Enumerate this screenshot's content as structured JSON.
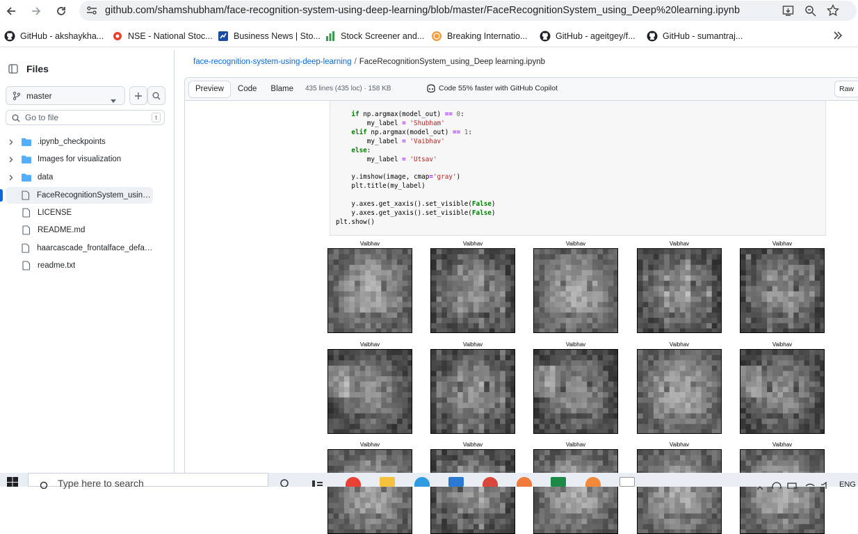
{
  "browser": {
    "url": "github.com/shamshubham/face-recognition-system-using-deep-learning/blob/master/FaceRecognitionSystem_using_Deep%20learning.ipynb",
    "bookmarks": [
      {
        "label": "GitHub - akshaykha...",
        "icon": "github-icon"
      },
      {
        "label": "NSE - National Stoc...",
        "icon": "nse-icon"
      },
      {
        "label": "Business News | Sto...",
        "icon": "business-news-icon"
      },
      {
        "label": "Stock Screener and...",
        "icon": "stock-screener-icon"
      },
      {
        "label": "Breaking Internatio...",
        "icon": "news-icon"
      },
      {
        "label": "GitHub - ageitgey/f...",
        "icon": "github-icon"
      },
      {
        "label": "GitHub - sumantraj...",
        "icon": "github-icon"
      }
    ]
  },
  "sidebar": {
    "title": "Files",
    "branch": "master",
    "search_placeholder": "Go to file",
    "search_shortcut": "t",
    "items": [
      {
        "label": ".ipynb_checkpoints",
        "type": "folder"
      },
      {
        "label": "Images for visualization",
        "type": "folder"
      },
      {
        "label": "data",
        "type": "folder"
      },
      {
        "label": "FaceRecognitionSystem_using_D...",
        "type": "file",
        "active": true
      },
      {
        "label": "LICENSE",
        "type": "file"
      },
      {
        "label": "README.md",
        "type": "file"
      },
      {
        "label": "haarcascade_frontalface_default....",
        "type": "file"
      },
      {
        "label": "readme.txt",
        "type": "file"
      }
    ]
  },
  "main": {
    "breadcrumb_repo": "face-recognition-system-using-deep-learning",
    "breadcrumb_sep": "/",
    "breadcrumb_file": "FaceRecognitionSystem_using_Deep learning.ipynb",
    "tabs": [
      "Preview",
      "Code",
      "Blame"
    ],
    "selected_tab": "Preview",
    "file_info": "435 lines (435 loc) · 158 KB",
    "copilot_text": "Code 55% faster with GitHub Copilot",
    "raw_label": "Raw"
  },
  "code_lines": [
    "    if np.argmax(model_out) == 0:",
    "        my_label = 'Shubham'",
    "    elif np.argmax(model_out) == 1:",
    "        my_label = 'Vaibhav'",
    "    else:",
    "        my_label = 'Utsav'",
    "",
    "    y.imshow(image, cmap='gray')",
    "    plt.title(my_label)",
    "",
    "    y.axes.get_xaxis().set_visible(False)",
    "    y.axes.get_yaxis().set_visible(False)",
    "plt.show()"
  ],
  "plot_titles": [
    "Vaibhav",
    "Vaibhav",
    "Vaibhav",
    "Vaibhav",
    "Vaibhav",
    "Vaibhav",
    "Vaibhav",
    "Vaibhav",
    "Vaibhav",
    "Vaibhav",
    "Vaibhav",
    "Vaibhav",
    "Vaibhav",
    "Vaibhav",
    "Vaibhav"
  ],
  "taskbar": {
    "search_placeholder": "Type here to search",
    "language": "ENG"
  },
  "colors": {
    "accent": "#0969da",
    "border": "#d1d9e0",
    "folder": "#54aeff"
  }
}
